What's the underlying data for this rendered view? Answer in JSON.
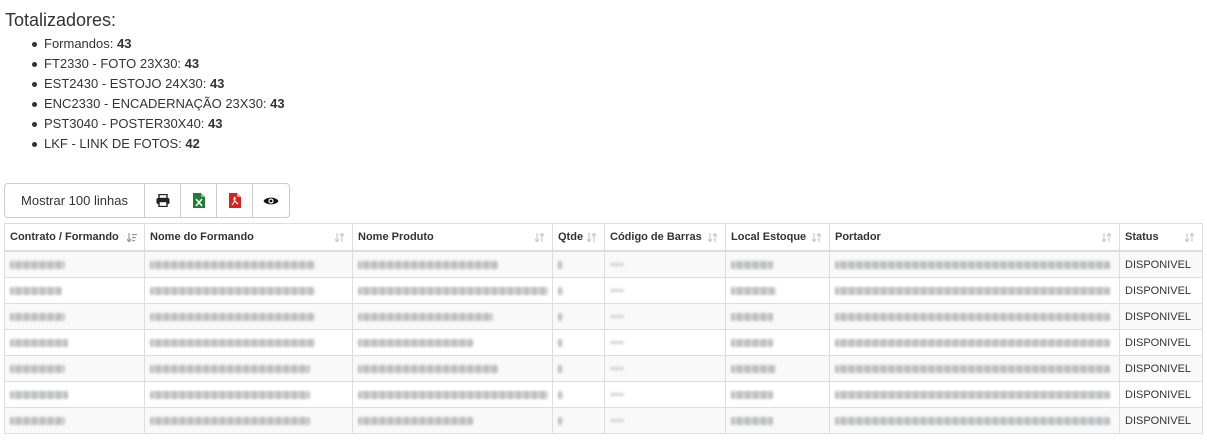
{
  "totalizadores": {
    "title": "Totalizadores:",
    "items": [
      {
        "label": "Formandos: ",
        "value": "43"
      },
      {
        "label": "FT2330 - FOTO 23X30: ",
        "value": "43"
      },
      {
        "label": "EST2430 - ESTOJO 24X30: ",
        "value": "43"
      },
      {
        "label": "ENC2330 - ENCADERNAÇÃO 23X30: ",
        "value": "43"
      },
      {
        "label": "PST3040 - POSTER30X40: ",
        "value": "43"
      },
      {
        "label": "LKF - LINK DE FOTOS: ",
        "value": "42"
      }
    ]
  },
  "toolbar": {
    "show_rows_label": "Mostrar 100 linhas",
    "icons": [
      "print-icon",
      "excel-icon",
      "pdf-icon",
      "eye-icon"
    ],
    "colors": {
      "excel": "#1e7e34",
      "pdf": "#e01e1e"
    }
  },
  "table": {
    "columns": [
      "Contrato / Formando",
      "Nome do Formando",
      "Nome Produto",
      "Qtde",
      "Código de Barras",
      "Local Estoque",
      "Portador",
      "Status"
    ],
    "rows": [
      {
        "status": "DISPONIVEL"
      },
      {
        "status": "DISPONIVEL"
      },
      {
        "status": "DISPONIVEL"
      },
      {
        "status": "DISPONIVEL"
      },
      {
        "status": "DISPONIVEL"
      },
      {
        "status": "DISPONIVEL"
      },
      {
        "status": "DISPONIVEL"
      }
    ]
  }
}
